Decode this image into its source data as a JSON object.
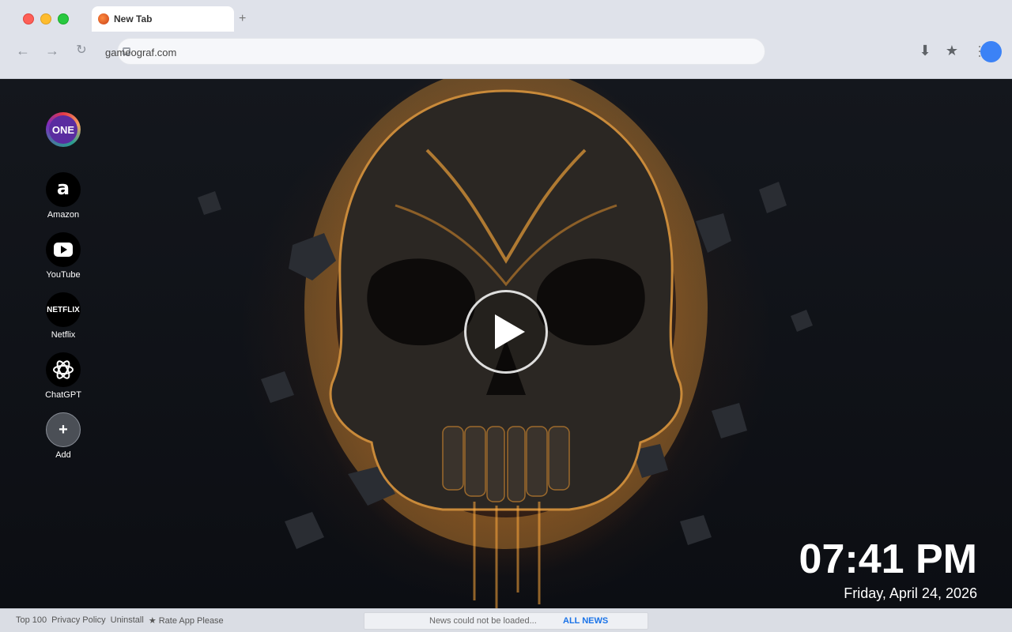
{
  "browser": {
    "tab_title": "New Tab",
    "new_tab_symbol": "+",
    "url": "gameograf.com",
    "nav": {
      "back": "←",
      "forward": "→",
      "reload": "↻"
    },
    "toolbar": {
      "download": "⬇",
      "bookmark": "★"
    }
  },
  "brand": {
    "logo_text": "ONE"
  },
  "shortcuts": [
    {
      "label": "Amazon",
      "glyph": "a",
      "icon": "amazon-icon"
    },
    {
      "label": "YouTube",
      "icon": "youtube-icon"
    },
    {
      "label": "Netflix",
      "glyph": "NETFLIX",
      "icon": "netflix-icon"
    },
    {
      "label": "ChatGPT",
      "icon": "chatgpt-icon"
    },
    {
      "label": "Add",
      "glyph": "+",
      "icon": "plus-icon"
    }
  ],
  "clock": {
    "time": "07:41 PM",
    "date": "Friday, April 24, 2026"
  },
  "footer": {
    "links": [
      "Top 100",
      "Privacy Policy",
      "Uninstall",
      "★ Rate App Please"
    ],
    "news_status": "News could not be loaded...",
    "news_all": "ALL NEWS"
  },
  "colors": {
    "accent": "#1a73e8",
    "profile": "#3b82f6"
  }
}
